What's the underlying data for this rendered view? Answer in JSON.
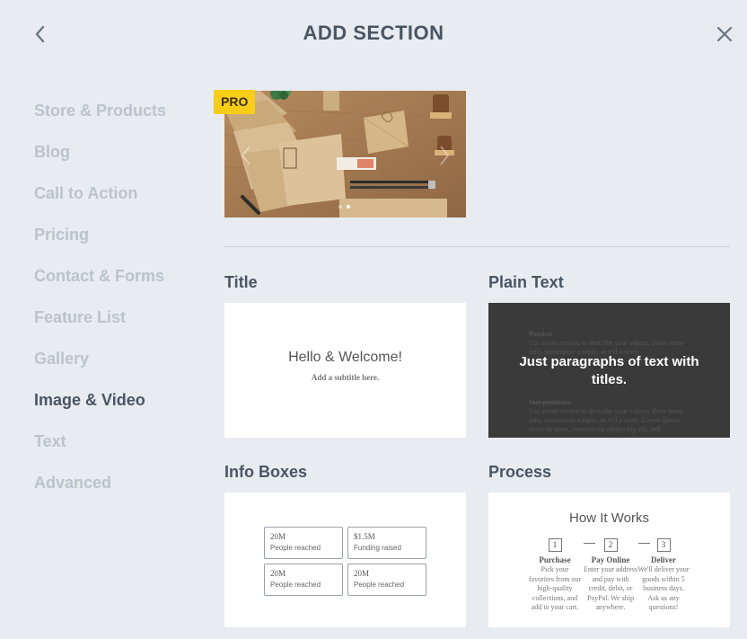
{
  "header": {
    "title": "ADD SECTION",
    "back_icon": "chevron-left-icon",
    "close_icon": "close-icon"
  },
  "sidebar": {
    "items": [
      {
        "label": "Store & Products",
        "active": false
      },
      {
        "label": "Blog",
        "active": false
      },
      {
        "label": "Call to Action",
        "active": false
      },
      {
        "label": "Pricing",
        "active": false
      },
      {
        "label": "Contact & Forms",
        "active": false
      },
      {
        "label": "Feature List",
        "active": false
      },
      {
        "label": "Gallery",
        "active": false
      },
      {
        "label": "Image & Video",
        "active": true
      },
      {
        "label": "Text",
        "active": false
      },
      {
        "label": "Advanced",
        "active": false
      }
    ]
  },
  "featured": {
    "badge": "PRO",
    "slide_dots": 2,
    "active_dot": 1
  },
  "sections": {
    "title": {
      "label": "Title",
      "preview_heading": "Hello & Welcome!",
      "preview_subtitle": "Add a subtitle here."
    },
    "plain_text": {
      "label": "Plain Text",
      "overlay": "Just paragraphs of text with titles.",
      "para1_title": "Passion",
      "para1_text": "Use a text section to describe your values, show some info, summarize a topic, or tell a story.",
      "para2_title": "Independence",
      "para2_text": "Use a text section to describe your values, show more info, summarize a topic, or tell a story. Lorem ipsum dolor sit amet, consectetur adipiscing elit, sed"
    },
    "info_boxes": {
      "label": "Info Boxes",
      "boxes": [
        {
          "value": "20M",
          "caption": "People reached"
        },
        {
          "value": "$1.5M",
          "caption": "Funding raised"
        },
        {
          "value": "20M",
          "caption": "People reached"
        },
        {
          "value": "20M",
          "caption": "People reached"
        }
      ]
    },
    "process": {
      "label": "Process",
      "preview_heading": "How It Works",
      "steps": [
        {
          "num": "1",
          "title": "Purchase",
          "text": "Pick your favorites from our high-quality collections, and add to your cart."
        },
        {
          "num": "2",
          "title": "Pay Online",
          "text": "Enter your address and pay with credit, debit, or PayPal. We ship anywhere."
        },
        {
          "num": "3",
          "title": "Deliver",
          "text": "We'll deliver your goods within 5 business days. Ask us any questions!"
        }
      ]
    }
  },
  "colors": {
    "background": "#e8ebf0",
    "text_primary": "#4a5563",
    "text_muted": "#bcc3cc",
    "pro_badge": "#f7cd18",
    "dark_card": "#3a3a3a"
  }
}
